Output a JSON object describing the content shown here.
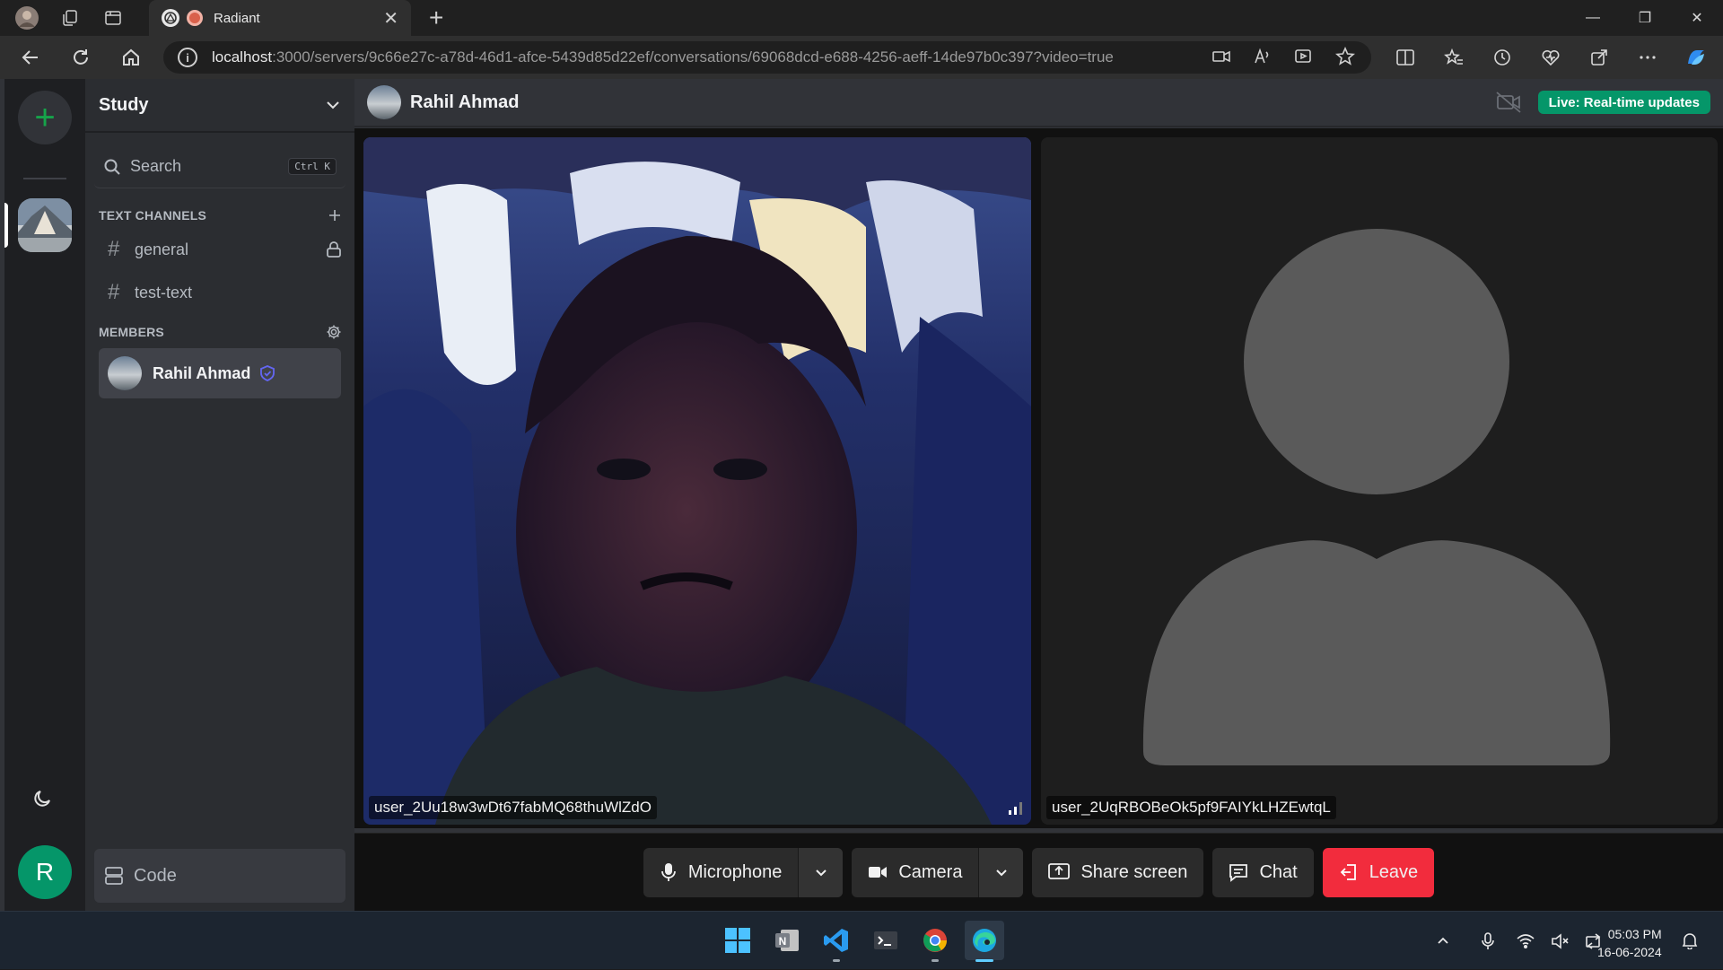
{
  "browser": {
    "tab_title": "Radiant",
    "url_host": "localhost",
    "url_rest": ":3000/servers/9c66e27c-a78d-46d1-afce-5439d85d22ef/conversations/69068dcd-e688-4256-aeff-14de97b0c397?video=true"
  },
  "sidebar": {
    "server_name": "Study",
    "search_label": "Search",
    "search_shortcut": "Ctrl K",
    "text_channels_heading": "TEXT CHANNELS",
    "channels": [
      {
        "name": "general",
        "locked": true
      },
      {
        "name": "test-text",
        "locked": false
      }
    ],
    "members_heading": "MEMBERS",
    "members": [
      {
        "name": "Rahil Ahmad",
        "role_icon": "shield-check-icon"
      }
    ],
    "code_label": "Code"
  },
  "rail": {
    "user_initial": "R"
  },
  "conversation": {
    "title": "Rahil Ahmad",
    "live_badge": "Live: Real-time updates"
  },
  "video": {
    "tiles": [
      {
        "participant": "user_2Uu18w3wDt67fabMQ68thuWlZdO",
        "camera_on": true
      },
      {
        "participant": "user_2UqRBOBeOk5pf9FAIYkLHZEwtqL",
        "camera_on": false
      }
    ],
    "controls": {
      "microphone": "Microphone",
      "camera": "Camera",
      "share_screen": "Share screen",
      "chat": "Chat",
      "leave": "Leave"
    }
  },
  "taskbar": {
    "time": "05:03 PM",
    "date": "16-06-2024"
  },
  "colors": {
    "accent_green": "#059669",
    "leave_red": "#f22c3d",
    "member_badge": "#6366f1"
  }
}
